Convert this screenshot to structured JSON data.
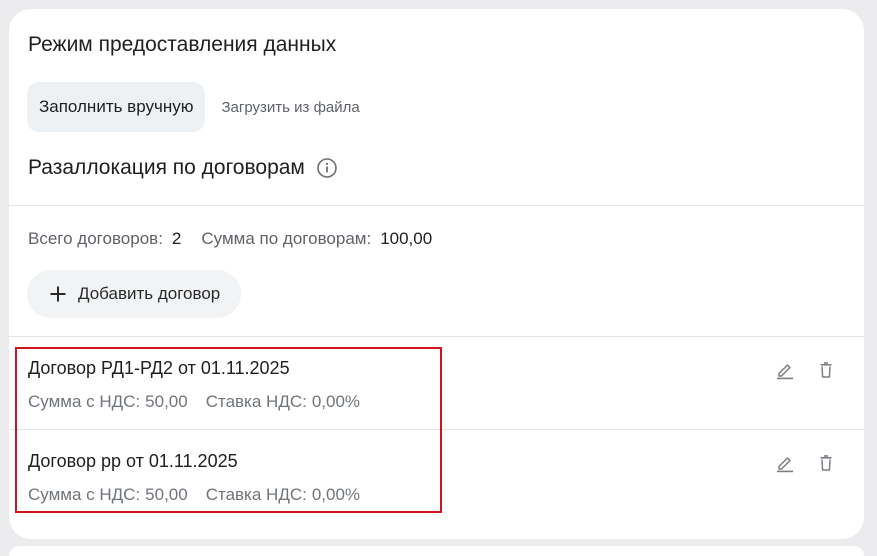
{
  "data_mode": {
    "title": "Режим предоставления данных",
    "tabs": [
      {
        "label": "Заполнить вручную",
        "active": true
      },
      {
        "label": "Загрузить из файла",
        "active": false
      }
    ]
  },
  "reallocation": {
    "title": "Разаллокация по договорам",
    "info_icon": "info-circle-icon"
  },
  "summary": {
    "total_label": "Всего договоров:",
    "total_value": "2",
    "sum_label": "Сумма по договорам:",
    "sum_value": "100,00"
  },
  "add_button": {
    "icon": "plus-icon",
    "label": "Добавить договор"
  },
  "contracts": [
    {
      "title": "Договор РД1-РД2 от 01.11.2025",
      "amount_label": "Сумма с НДС:",
      "amount_value": "50,00",
      "vat_label": "Ставка НДС:",
      "vat_value": "0,00%"
    },
    {
      "title": "Договор рр от 01.11.2025",
      "amount_label": "Сумма с НДС:",
      "amount_value": "50,00",
      "vat_label": "Ставка НДС:",
      "vat_value": "0,00%"
    }
  ],
  "colors": {
    "background": "#ececee",
    "card": "#ffffff",
    "active_tab": "#edf1f4",
    "secondary_text": "#70757a",
    "highlight_border": "#d0141b"
  }
}
